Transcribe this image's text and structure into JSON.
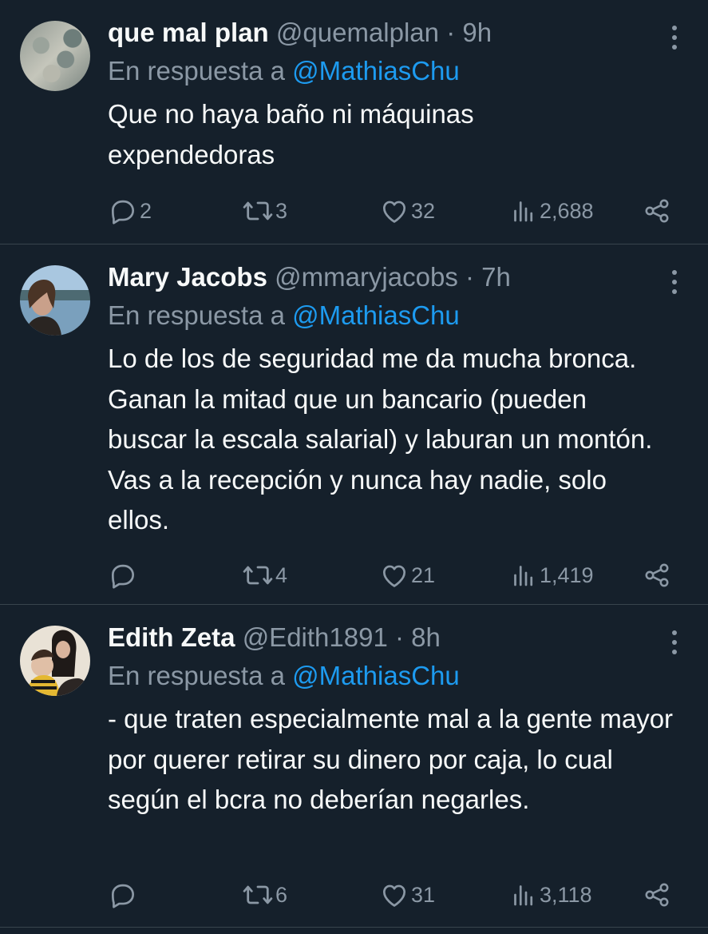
{
  "tweets": [
    {
      "name": "que mal plan",
      "handle": "@quemalplan",
      "time": "9h",
      "reply_prefix": "En respuesta a",
      "reply_to": "@MathiasChu",
      "text": "Que no haya baño ni máquinas expendedoras",
      "replies": "2",
      "retweets": "3",
      "likes": "32",
      "views": "2,688"
    },
    {
      "name": "Mary Jacobs",
      "handle": "@mmaryjacobs",
      "time": "7h",
      "reply_prefix": "En respuesta a",
      "reply_to": "@MathiasChu",
      "text": "Lo de los de seguridad me da mucha bronca. Ganan la mitad que un bancario (pueden buscar la escala salarial) y laburan un montón. Vas a la recepción y nunca hay nadie, solo ellos.",
      "replies": "",
      "retweets": "4",
      "likes": "21",
      "views": "1,419"
    },
    {
      "name": "Edith Zeta",
      "handle": "@Edith1891",
      "time": "8h",
      "reply_prefix": "En respuesta a",
      "reply_to": "@MathiasChu",
      "text": "- que traten especialmente mal a la gente mayor por querer retirar su dinero por caja, lo cual según el bcra no deberían negarles.",
      "replies": "",
      "retweets": "6",
      "likes": "31",
      "views": "3,118"
    }
  ],
  "dot": "·",
  "colors": {
    "background": "#15202b",
    "text": "#f7f9f9",
    "muted": "#8b98a5",
    "accent": "#1d9bf0",
    "divider": "#38444d"
  },
  "icons": [
    "reply-icon",
    "retweet-icon",
    "like-icon",
    "views-icon",
    "share-icon",
    "more-icon"
  ]
}
